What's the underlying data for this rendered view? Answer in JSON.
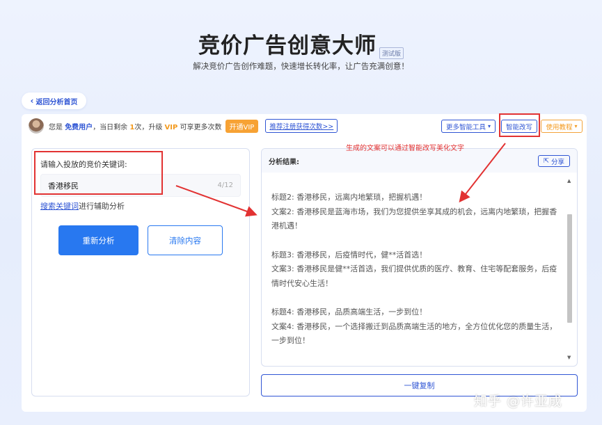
{
  "hero": {
    "title": "竞价广告创意大师",
    "beta_tag": "测试版",
    "subtitle": "解决竞价广告创作难题，快速增长转化率，让广告充满创意！"
  },
  "nav": {
    "back_label": "返回分析首页"
  },
  "user_bar": {
    "greeting_prefix": "您是",
    "user_type": "免费用户",
    "middle": "，当日剩余",
    "remaining": "1",
    "upgrade_text": "次，升级",
    "vip": "VIP",
    "vip_suffix": "可享更多次数",
    "open_vip": "开通VIP",
    "reco_link": "推荐注册获得次数>>",
    "more_tools": "更多智能工具",
    "smart_rewrite": "智能改写",
    "tutorial": "使用教程"
  },
  "left": {
    "keyword_label": "请输入投放的竞价关键词:",
    "keyword_value": "香港移民",
    "keyword_count": "4/12",
    "helper_link": "搜索关键词",
    "helper_suffix": "进行辅助分析",
    "reanalyze": "重新分析",
    "clear": "清除内容"
  },
  "right": {
    "header": "分析结果:",
    "share": "分享",
    "entries": [
      {
        "title": "标题2:  香港移民，远离内地繁琐，把握机遇！",
        "copy": "文案2:  香港移民是蓝海市场，我们为您提供坐享其成的机会，远离内地繁琐，把握香港机遇！"
      },
      {
        "title": "标题3:  香港移民，后疫情时代，健**活首选！",
        "copy": "文案3:  香港移民是健**活首选，我们提供优质的医疗、教育、住宅等配套服务，后疫情时代安心生活！"
      },
      {
        "title": "标题4:  香港移民，品质高端生活，一步到位！",
        "copy": "文案4:  香港移民，一个选择搬迁到品质高端生活的地方，全方位优化您的质量生活，一步到位！"
      }
    ],
    "copy_button": "一键复制"
  },
  "annotation": {
    "text": "生成的文案可以通过智能改写美化文字",
    "color": "#e23232"
  },
  "watermark": "知乎 @许亚成",
  "colors": {
    "primary": "#2878f0",
    "link": "#2f55d4",
    "vip_orange": "#f7a234",
    "annotation_red": "#e23232"
  }
}
